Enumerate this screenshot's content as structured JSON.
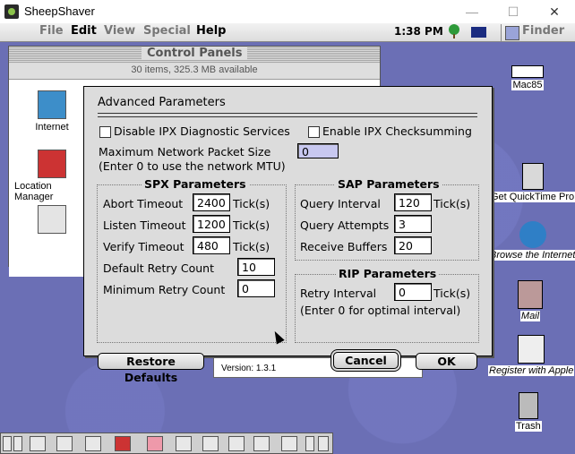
{
  "host": {
    "title": "SheepShaver",
    "buttons": {
      "minimize": "—",
      "maximize": "☐",
      "close": "✕"
    }
  },
  "menubar": {
    "items": [
      "File",
      "Edit",
      "View",
      "Special",
      "Help"
    ],
    "clock": "1:38 PM",
    "app": "Finder",
    "icons": [
      "apple-icon",
      "tree-icon",
      "australia-flag-icon"
    ]
  },
  "control_panels": {
    "title": "Control Panels",
    "info": "30 items, 325.3 MB available",
    "items": [
      "Internet",
      "Location Manager"
    ]
  },
  "about_window": {
    "version": "Version: 1.3.1"
  },
  "desktop_icons": [
    "Mac85",
    "Get QuickTime Pro",
    "Browse the Internet",
    "Mail",
    "Register with Apple",
    "Trash"
  ],
  "dialog": {
    "title": "Advanced Parameters",
    "disable_ipx": "Disable IPX Diagnostic Services",
    "enable_ipx_checksum": "Enable IPX Checksumming",
    "max_packet_label": "Maximum Network Packet Size",
    "max_packet_hint": "(Enter 0 to use the network MTU)",
    "max_packet_value": "0",
    "spx": {
      "title": "SPX Parameters",
      "abort_label": "Abort Timeout",
      "abort_value": "2400",
      "listen_label": "Listen Timeout",
      "listen_value": "1200",
      "verify_label": "Verify Timeout",
      "verify_value": "480",
      "retry_label": "Default Retry Count",
      "retry_value": "10",
      "minretry_label": "Minimum Retry Count",
      "minretry_value": "0",
      "unit": "Tick(s)"
    },
    "sap": {
      "title": "SAP Parameters",
      "query_interval_label": "Query Interval",
      "query_interval_value": "120",
      "query_attempts_label": "Query Attempts",
      "query_attempts_value": "3",
      "receive_buffers_label": "Receive Buffers",
      "receive_buffers_value": "20",
      "unit": "Tick(s)"
    },
    "rip": {
      "title": "RIP Parameters",
      "retry_interval_label": "Retry Interval",
      "retry_interval_value": "0",
      "unit": "Tick(s)",
      "hint": "(Enter 0 for optimal interval)"
    },
    "restore_label": "Restore Defaults",
    "cancel_label": "Cancel",
    "ok_label": "OK"
  }
}
